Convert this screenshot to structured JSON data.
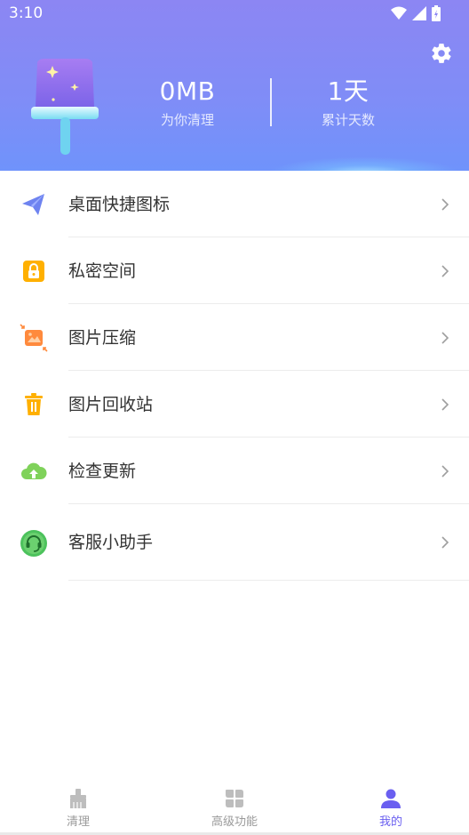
{
  "status_bar": {
    "time": "3:10"
  },
  "header": {
    "stats": [
      {
        "value": "0MB",
        "label": "为你清理"
      },
      {
        "value": "1天",
        "label": "累计天数"
      }
    ]
  },
  "menu": [
    {
      "label": "桌面快捷图标",
      "icon": "paper-plane-icon"
    },
    {
      "label": "私密空间",
      "icon": "lock-icon"
    },
    {
      "label": "图片压缩",
      "icon": "image-compress-icon"
    },
    {
      "label": "图片回收站",
      "icon": "trash-icon"
    },
    {
      "label": "检查更新",
      "icon": "cloud-upload-icon"
    },
    {
      "label": "客服小助手",
      "icon": "headset-icon"
    }
  ],
  "bottom_nav": [
    {
      "label": "清理",
      "icon": "broom-icon",
      "active": false
    },
    {
      "label": "高级功能",
      "icon": "grid-icon",
      "active": false
    },
    {
      "label": "我的",
      "icon": "user-icon",
      "active": true
    }
  ],
  "colors": {
    "header_gradient_start": "#8c86f3",
    "header_gradient_end": "#6f93fb",
    "active_tab": "#6a5ff0",
    "inactive_tab": "#9a9a9a"
  }
}
